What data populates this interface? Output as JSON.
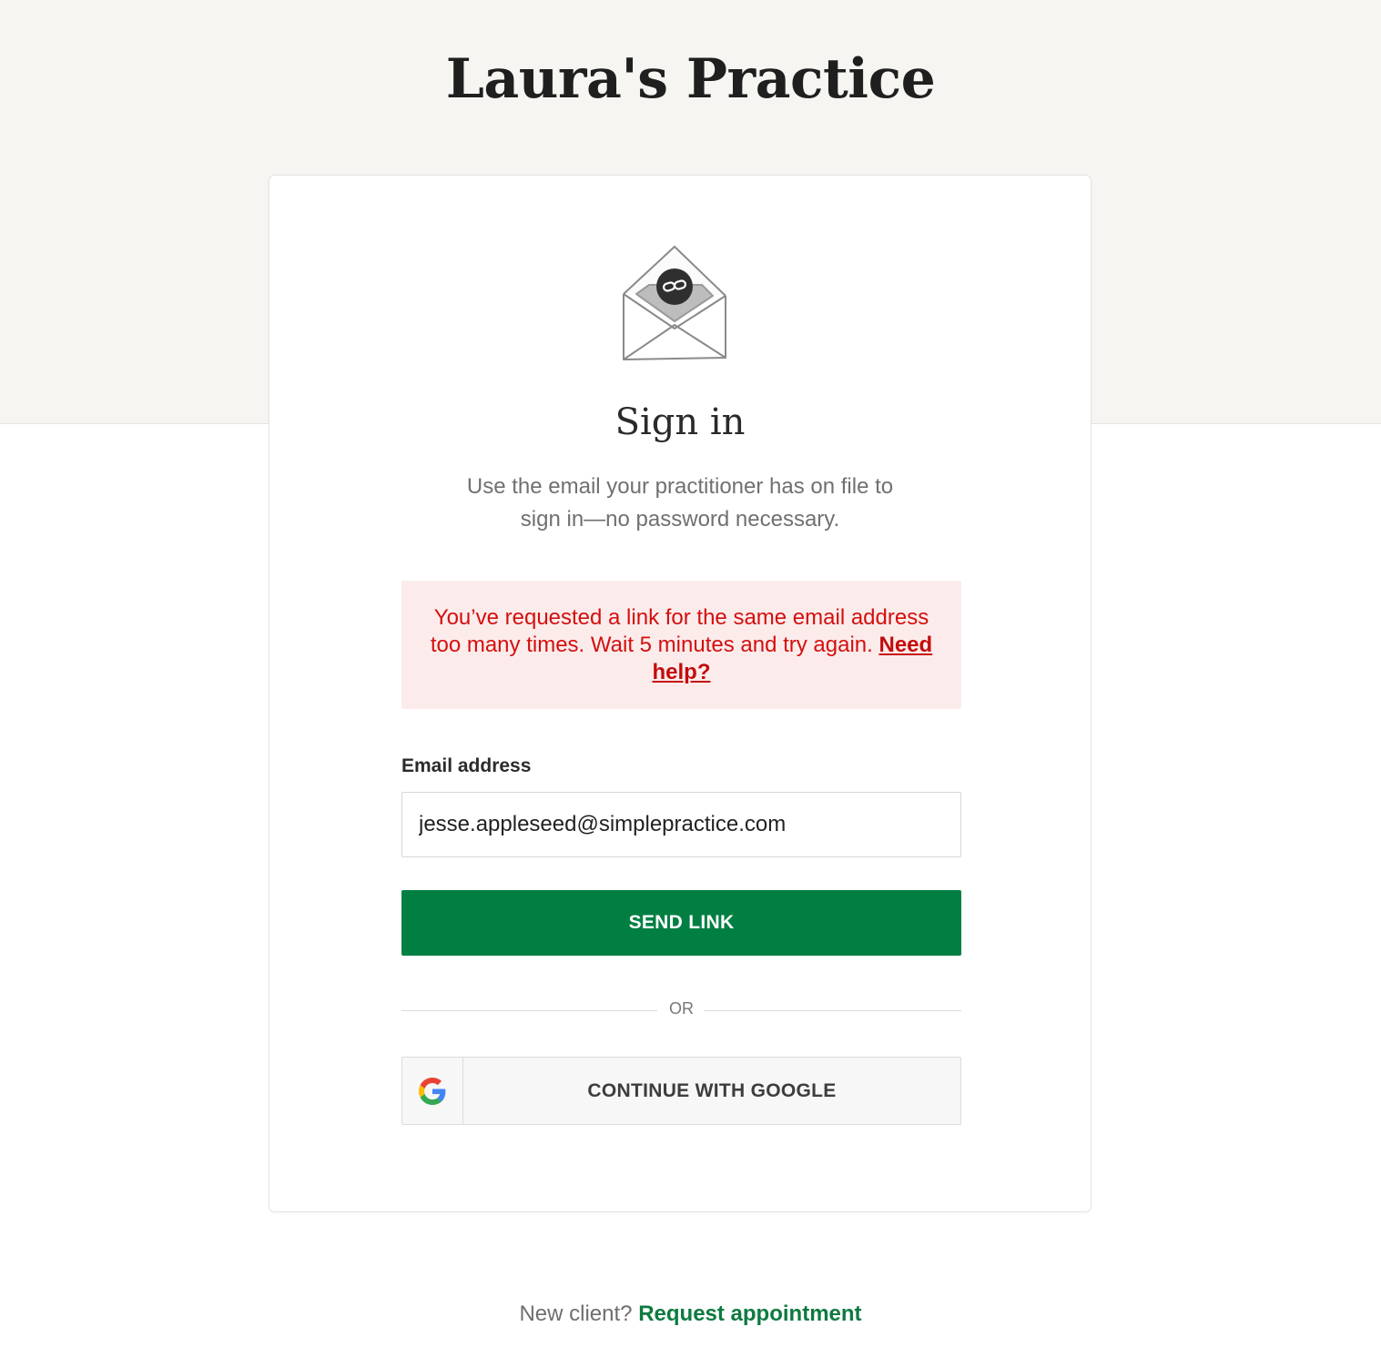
{
  "header": {
    "practice_name": "Laura's Practice"
  },
  "signin": {
    "heading": "Sign in",
    "subtitle": "Use the email your practitioner has on file to sign in—no password necessary.",
    "icon": "envelope-link-icon"
  },
  "error": {
    "message": "You’ve requested a link for the same email address too many times. Wait 5 minutes and try again.",
    "help_link": "Need help?",
    "color": "#d40f0f"
  },
  "form": {
    "email_label": "Email address",
    "email_value": "jesse.appleseed@simplepractice.com",
    "send_button": "SEND LINK",
    "divider": "OR",
    "google_button": "CONTINUE WITH GOOGLE"
  },
  "footer": {
    "prompt": "New client?",
    "link": "Request appointment"
  },
  "colors": {
    "accent": "#017f42",
    "background_band": "#f6f5f1",
    "error_background": "#fbeceb"
  }
}
